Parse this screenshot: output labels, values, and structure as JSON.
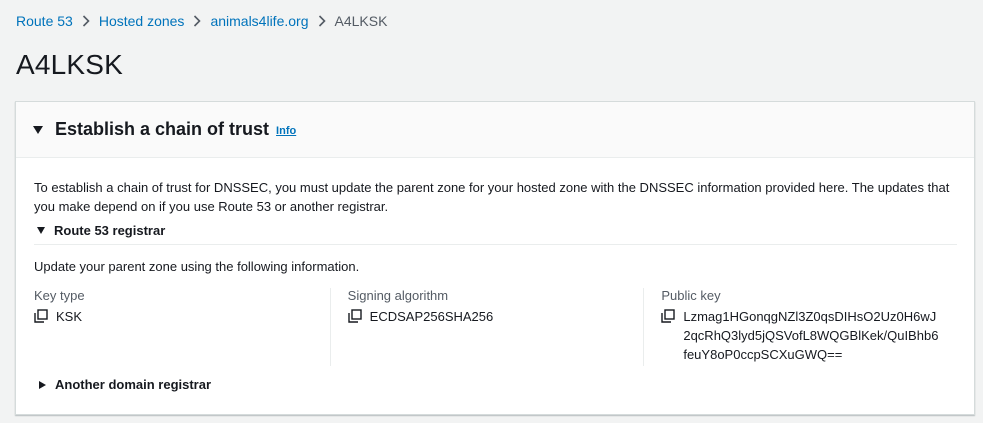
{
  "breadcrumb": {
    "items": [
      "Route 53",
      "Hosted zones",
      "animals4life.org"
    ],
    "current": "A4LKSK"
  },
  "page": {
    "title": "A4LKSK"
  },
  "panel": {
    "title": "Establish a chain of trust",
    "info": "Info",
    "intro": "To establish a chain of trust for DNSSEC, you must update the parent zone for your hosted zone with the DNSSEC information provided here. The updates that you make depend on if you use Route 53 or another registrar.",
    "route53": {
      "title": "Route 53 registrar",
      "instructions": "Update your parent zone using the following information.",
      "key_type": {
        "label": "Key type",
        "value": "KSK"
      },
      "signing_algorithm": {
        "label": "Signing algorithm",
        "value": "ECDSAP256SHA256"
      },
      "public_key": {
        "label": "Public key",
        "value": "Lzmag1HGonqgNZl3Z0qsDIHsO2Uz0H6wJ2qcRhQ3lyd5jQSVofL8WQGBlKek/QuIBhb6feuY8oP0ccpSCXuGWQ=="
      }
    },
    "another": {
      "title": "Another domain registrar"
    }
  },
  "colors": {
    "link": "#0073bb",
    "text": "#16191f",
    "muted": "#545b64",
    "background": "#f2f3f3"
  }
}
